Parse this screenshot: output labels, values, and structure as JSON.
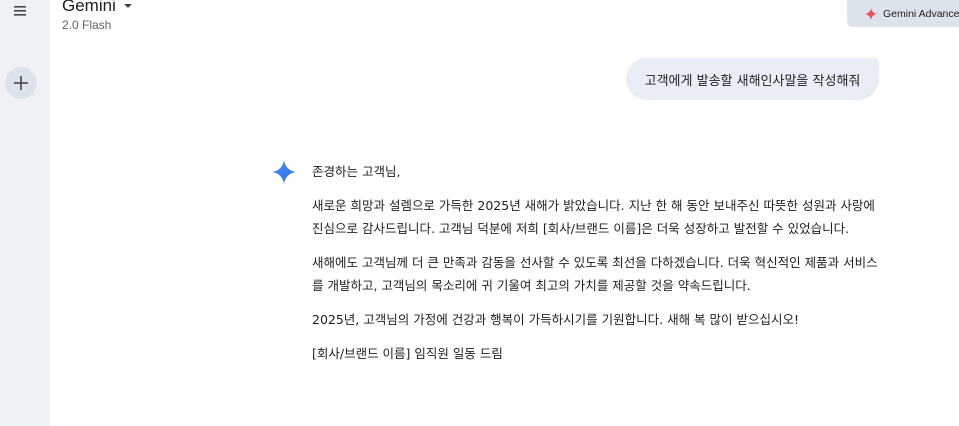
{
  "header": {
    "model_name": "Gemini",
    "model_version": "2.0 Flash",
    "advanced_label": "Gemini Advance"
  },
  "sidebar": {
    "menu_icon": "hamburger-menu-icon",
    "new_chat_icon": "plus-icon"
  },
  "conversation": {
    "user_message": "고객에게 발송할 새해인사말을 작성해줘",
    "response": {
      "greeting": "존경하는 고객님,",
      "paragraph1": "새로운 희망과 설렘으로 가득한 2025년 새해가 밝았습니다. 지난 한 해 동안 보내주신 따뜻한 성원과 사랑에 진심으로 감사드립니다. 고객님 덕분에 저희 [회사/브랜드 이름]은 더욱 성장하고 발전할 수 있었습니다.",
      "paragraph2": "새해에도 고객님께 더 큰 만족과 감동을 선사할 수 있도록 최선을 다하겠습니다. 더욱 혁신적인 제품과 서비스를 개발하고, 고객님의 목소리에 귀 기울여 최고의 가치를 제공할 것을 약속드립니다.",
      "paragraph3": "2025년, 고객님의 가정에 건강과 행복이 가득하시기를 기원합니다. 새해 복 많이 받으십시오!",
      "signature": "[회사/브랜드 이름] 임직원 일동 드림"
    }
  },
  "colors": {
    "sidebar_bg": "#eef2f6",
    "user_bubble_bg": "#e9eef6",
    "advanced_btn_bg": "#dde3ea",
    "accent_red": "#e8505b",
    "gemini_blue": "#4285f4"
  }
}
